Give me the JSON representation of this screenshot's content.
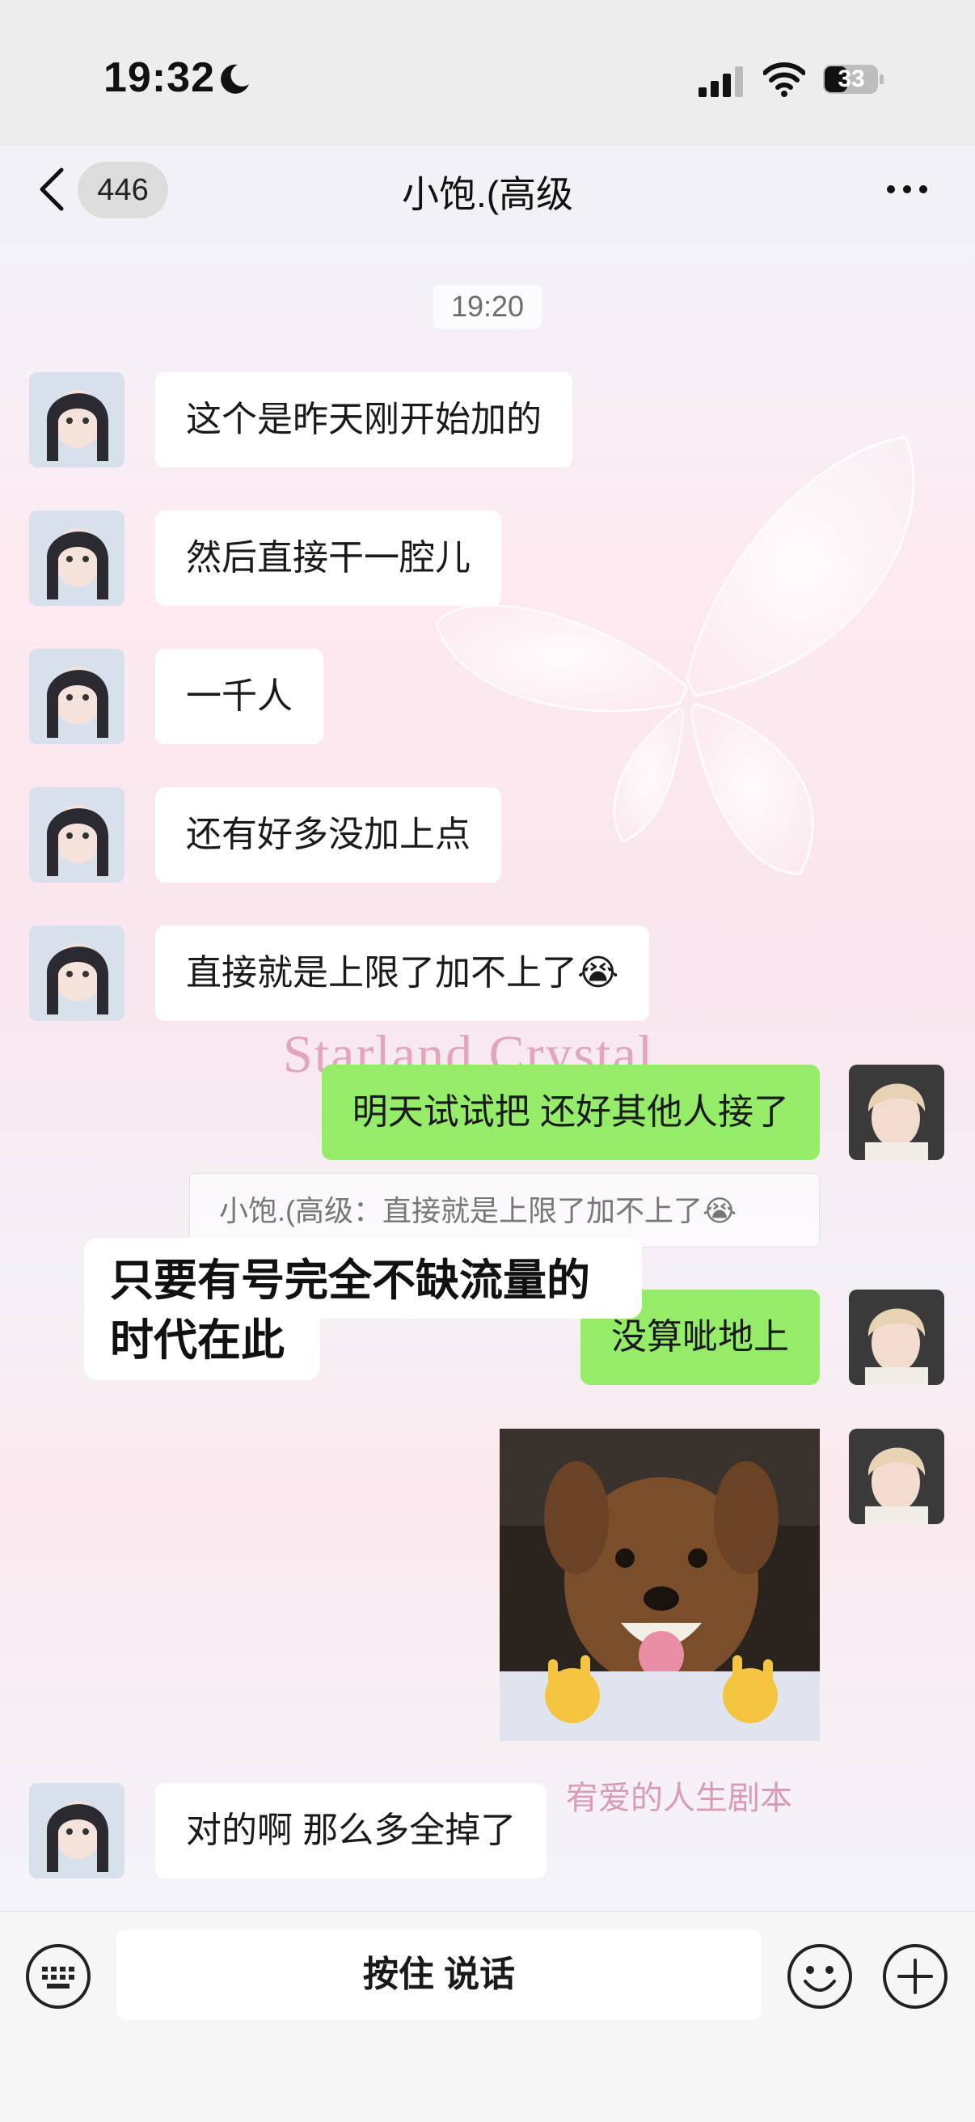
{
  "status_bar": {
    "time": "19:32",
    "battery": "33"
  },
  "header": {
    "unread_count": "446",
    "title": "小饱.(高级"
  },
  "chat": {
    "timestamp": "19:20",
    "background_text": "Starland Crystal",
    "background_text2": "宥爱的人生剧本",
    "messages": [
      {
        "side": "left",
        "text": "这个是昨天刚开始加的"
      },
      {
        "side": "left",
        "text": "然后直接干一腔儿"
      },
      {
        "side": "left",
        "text": "一千人"
      },
      {
        "side": "left",
        "text": "还有好多没加上点"
      },
      {
        "side": "left",
        "text": "直接就是上限了加不上了😭"
      },
      {
        "side": "right",
        "text": "明天试试把 还好其他人接了"
      },
      {
        "side": "right",
        "text": "没算呲地上"
      },
      {
        "side": "right",
        "type": "image",
        "text": ""
      },
      {
        "side": "left",
        "text": "对的啊 那么多全掉了"
      }
    ],
    "quote": "小饱.(高级：直接就是上限了加不上了😭",
    "caption_line1": "只要有号完全不缺流量的",
    "caption_line2": "时代在此"
  },
  "input_bar": {
    "voice_label": "按住 说话"
  },
  "colors": {
    "bubble_right": "#95ec69",
    "bubble_left": "#ffffff",
    "bar": "#ededed"
  },
  "icons": [
    "moon-icon",
    "signal-icon",
    "wifi-icon",
    "battery-icon",
    "back-chevron-icon",
    "more-icon",
    "keyboard-icon",
    "emoji-icon",
    "plus-icon"
  ]
}
